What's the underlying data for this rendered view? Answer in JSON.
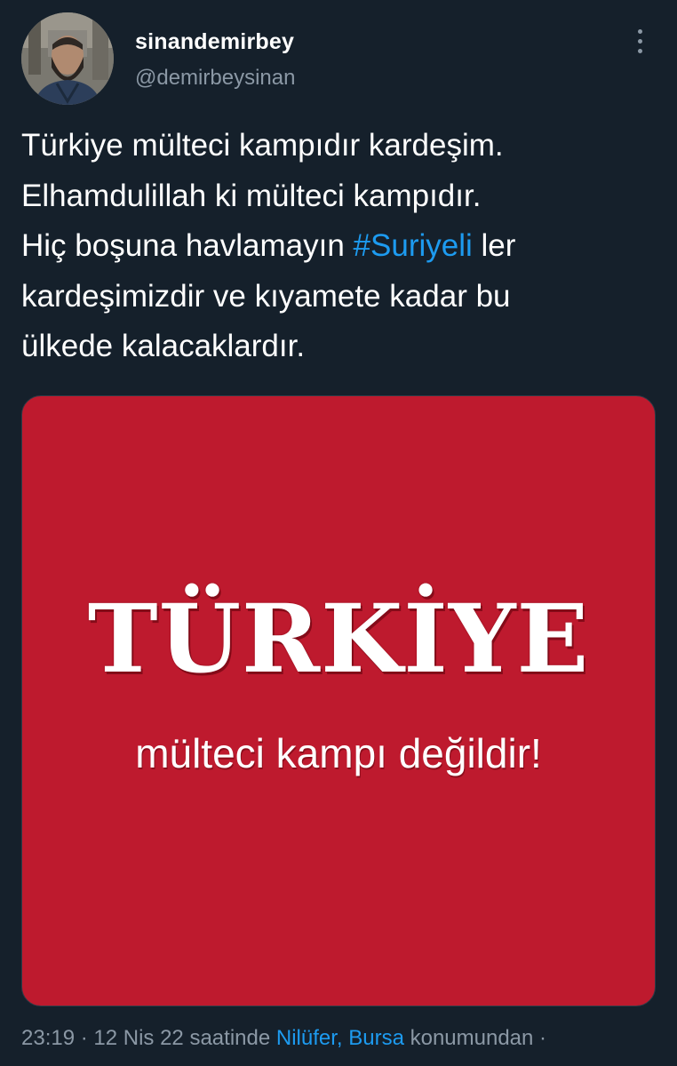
{
  "user": {
    "display_name": "sinandemirbey",
    "handle": "@demirbeysinan",
    "avatar": "profile-photo"
  },
  "tweet": {
    "lines": [
      "Türkiye mülteci kampıdır kardeşim.",
      "Elhamdulillah ki mülteci kampıdır.",
      "kardeşimizdir ve kıyamete kadar bu",
      "ülkede kalacaklardır."
    ],
    "line3_before": "Hiç boşuna havlamayın ",
    "hashtag": "#Suriyeli",
    "line3_after": " ler"
  },
  "media": {
    "headline": "TÜRKİYE",
    "subtitle": "mülteci kampı değildir!",
    "background_color": "#be1a2e"
  },
  "meta": {
    "time": "23:19",
    "sep1": " · ",
    "date": "12 Nis 22",
    "saatinde": " saatinde ",
    "location": "Nilüfer, Bursa",
    "suffix": " konumundan ·"
  },
  "colors": {
    "background": "#15202b",
    "link": "#1d9bf0",
    "secondary_text": "#8b98a5"
  },
  "icons": {
    "more": "more-dots-icon"
  }
}
